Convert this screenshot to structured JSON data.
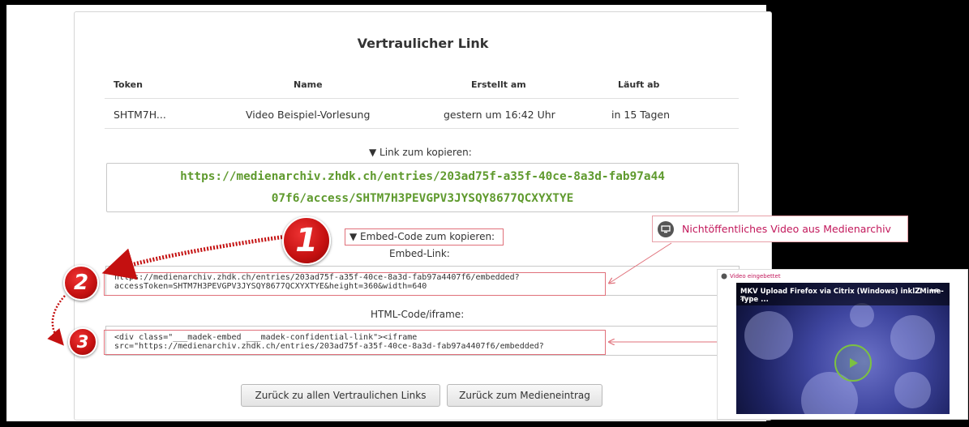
{
  "title": "Vertraulicher Link",
  "table": {
    "headers": [
      "Token",
      "Name",
      "Erstellt am",
      "Läuft ab"
    ],
    "row": [
      "SHTM7H...",
      "Video Beispiel-Vorlesung",
      "gestern um 16:42 Uhr",
      "in 15 Tagen"
    ]
  },
  "link_section": {
    "caption": "▼ Link zum kopieren:",
    "line1": "https://medienarchiv.zhdk.ch/entries/203ad75f-a35f-40ce-8a3d-fab97a44",
    "line2": "07f6/access/SHTM7H3PEVGPV3JYSQY8677QCXYXTYE"
  },
  "embed_section": {
    "caption": "▼ Embed-Code zum kopieren:",
    "embed_link_label": "Embed-Link:",
    "embed_line1": "https://medienarchiv.zhdk.ch/entries/203ad75f-a35f-40ce-8a3d-fab97a4407f6/embedded?",
    "embed_line2": "accessToken=SHTM7H3PEVGPV3JYSQY8677QCXYXTYE&height=360&width=640",
    "html_label": "HTML-Code/iframe:",
    "html_line1": "<div class=\"___madek-embed ___madek-confidential-link\"><iframe",
    "html_line2": "src=\"https://medienarchiv.zhdk.ch/entries/203ad75f-a35f-40ce-8a3d-fab97a4407f6/embedded?"
  },
  "buttons": {
    "back_all": "Zurück zu allen Vertraulichen Links",
    "back_entry": "Zurück zum Medieneintrag"
  },
  "markers": [
    "1",
    "2",
    "3"
  ],
  "callout": {
    "text": "Nichtöffentliches Video aus Medienarchiv",
    "icon": "display-icon"
  },
  "video": {
    "label": "Video eingebettet",
    "title": "MKV Upload Firefox via Citrix (Windows) inkl. Mime-Type ...",
    "channel": "ZHdK",
    "logo": "Z",
    "logo_small": "hdk"
  },
  "colors": {
    "link_green": "#5f9a2e",
    "marker_red": "#c41010",
    "highlight_pink": "#e0707a",
    "callout_text": "#c2185b"
  }
}
